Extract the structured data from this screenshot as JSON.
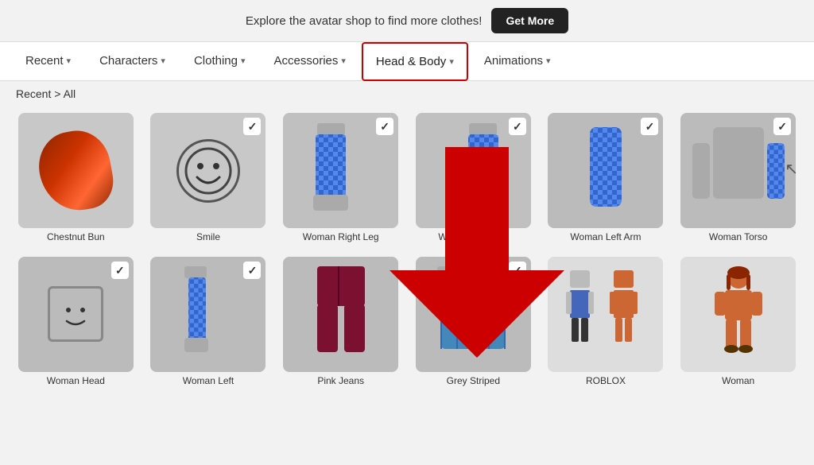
{
  "topbar": {
    "promo_text": "Explore the avatar shop to find more clothes!",
    "get_more_label": "Get More"
  },
  "nav": {
    "tabs": [
      {
        "id": "recent",
        "label": "Recent",
        "active": false
      },
      {
        "id": "characters",
        "label": "Characters",
        "active": false
      },
      {
        "id": "clothing",
        "label": "Clothing",
        "active": false
      },
      {
        "id": "accessories",
        "label": "Accessories",
        "active": false
      },
      {
        "id": "head-body",
        "label": "Head & Body",
        "active": true
      },
      {
        "id": "animations",
        "label": "Animations",
        "active": false
      }
    ]
  },
  "breadcrumb": {
    "root": "Recent",
    "separator": ">",
    "current": "All"
  },
  "items_row1": [
    {
      "id": "chestnut-bun",
      "label": "Chestnut Bun",
      "selected": false,
      "type": "hair"
    },
    {
      "id": "smile",
      "label": "Smile",
      "selected": true,
      "type": "face"
    },
    {
      "id": "woman-right-leg",
      "label": "Woman Right Leg",
      "selected": true,
      "type": "leg"
    },
    {
      "id": "woman-left-leg",
      "label": "Woman Left Leg",
      "selected": true,
      "type": "leg"
    },
    {
      "id": "woman-left-arm",
      "label": "Woman Left Arm",
      "selected": true,
      "type": "arm"
    },
    {
      "id": "woman-torso",
      "label": "Woman Torso",
      "selected": true,
      "type": "torso"
    }
  ],
  "items_row2": [
    {
      "id": "woman-head",
      "label": "Woman Head",
      "selected": true,
      "type": "head"
    },
    {
      "id": "woman-left-2",
      "label": "Woman Left",
      "selected": true,
      "type": "arm"
    },
    {
      "id": "pink-jeans",
      "label": "Pink Jeans",
      "selected": false,
      "type": "pants"
    },
    {
      "id": "grey-striped",
      "label": "Grey Striped",
      "selected": true,
      "type": "shirt"
    },
    {
      "id": "roblox",
      "label": "ROBLOX",
      "selected": false,
      "type": "character"
    },
    {
      "id": "woman",
      "label": "Woman",
      "selected": false,
      "type": "character"
    }
  ]
}
